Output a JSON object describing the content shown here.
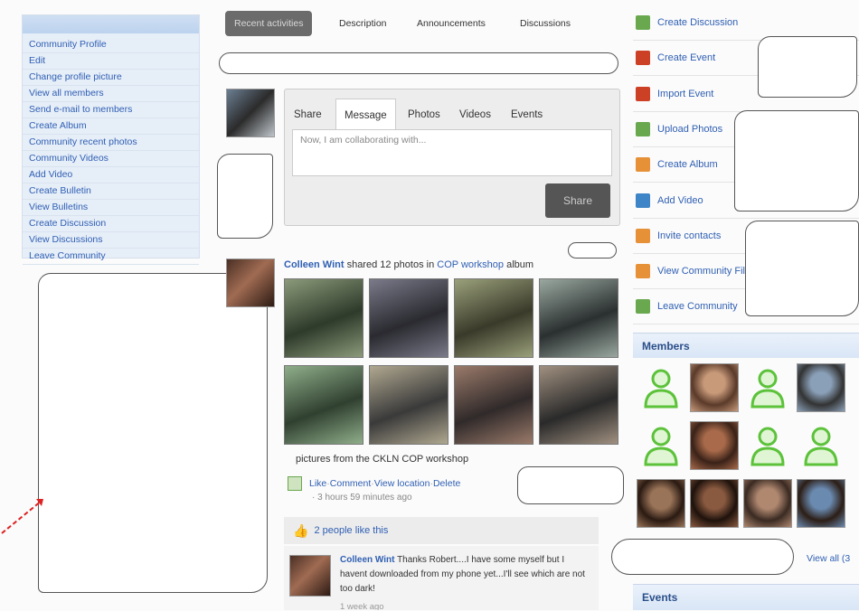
{
  "left_nav": [
    "Community Profile",
    "Edit",
    "Change profile picture",
    "View all members",
    "Send e-mail to members",
    "Create Album",
    "Community recent photos",
    "Community Videos",
    "Add Video",
    "Create Bulletin",
    "View Bulletins",
    "Create Discussion",
    "View Discussions",
    "Leave Community"
  ],
  "tabs": [
    "Recent activities",
    "Description",
    "Announcements",
    "Discussions"
  ],
  "composer": {
    "tabs": [
      "Share",
      "Message",
      "Photos",
      "Videos",
      "Events"
    ],
    "placeholder": "Now, I am collaborating with...",
    "share_label": "Share"
  },
  "activity": {
    "user": "Colleen Wint",
    "verb": " shared 12 photos in ",
    "album": "COP workshop",
    "suffix": " album",
    "caption": "pictures from the CKLN COP workshop",
    "like": "Like",
    "comment": "Comment",
    "view_location": "View location",
    "delete": "Delete",
    "sep": " · ",
    "time": "3 hours 59 minutes ago",
    "likes_text": "2 people like this"
  },
  "comment": {
    "user": "Colleen Wint",
    "text": " Thanks Robert....I have some myself but I havent downloaded from my phone yet...I'll see which are not too dark!",
    "time": "1 week ago"
  },
  "right_actions": [
    {
      "label": "Create Discussion",
      "icon": "discussion-icon",
      "color": "#6aa84f"
    },
    {
      "label": "Create Event",
      "icon": "calendar-add-icon",
      "color": "#cc4125"
    },
    {
      "label": "Import Event",
      "icon": "calendar-import-icon",
      "color": "#cc4125"
    },
    {
      "label": "Upload Photos",
      "icon": "photo-upload-icon",
      "color": "#6aa84f"
    },
    {
      "label": "Create Album",
      "icon": "album-icon",
      "color": "#e69138"
    },
    {
      "label": "Add Video",
      "icon": "video-icon",
      "color": "#3d85c6"
    },
    {
      "label": "Invite contacts",
      "icon": "contacts-icon",
      "color": "#e69138"
    },
    {
      "label": "View Community File",
      "icon": "file-icon",
      "color": "#e69138"
    },
    {
      "label": "Leave Community",
      "icon": "leave-icon",
      "color": "#6aa84f"
    }
  ],
  "members_title": "Members",
  "members": [
    {
      "type": "placeholder"
    },
    {
      "type": "photo",
      "c1": "#5a3a2a",
      "c2": "#c89a7a"
    },
    {
      "type": "placeholder"
    },
    {
      "type": "photo",
      "c1": "#333",
      "c2": "#8aa0b8"
    },
    {
      "type": "placeholder"
    },
    {
      "type": "photo",
      "c1": "#3a2218",
      "c2": "#a86a4a"
    },
    {
      "type": "placeholder"
    },
    {
      "type": "placeholder"
    },
    {
      "type": "photo",
      "c1": "#2a1a12",
      "c2": "#9a7458"
    },
    {
      "type": "photo",
      "c1": "#1e120c",
      "c2": "#8a5a40"
    },
    {
      "type": "photo",
      "c1": "#3a2a22",
      "c2": "#b08870"
    },
    {
      "type": "photo",
      "c1": "#2c1e16",
      "c2": "#6a8ab0"
    }
  ],
  "view_all": "View all (3",
  "events_title": "Events",
  "colors": {
    "link": "#2f5fb3",
    "header_blue": "#2b4f8a",
    "tab_active": "#6b6b6b",
    "placeholder_green": "#5cc23a"
  }
}
